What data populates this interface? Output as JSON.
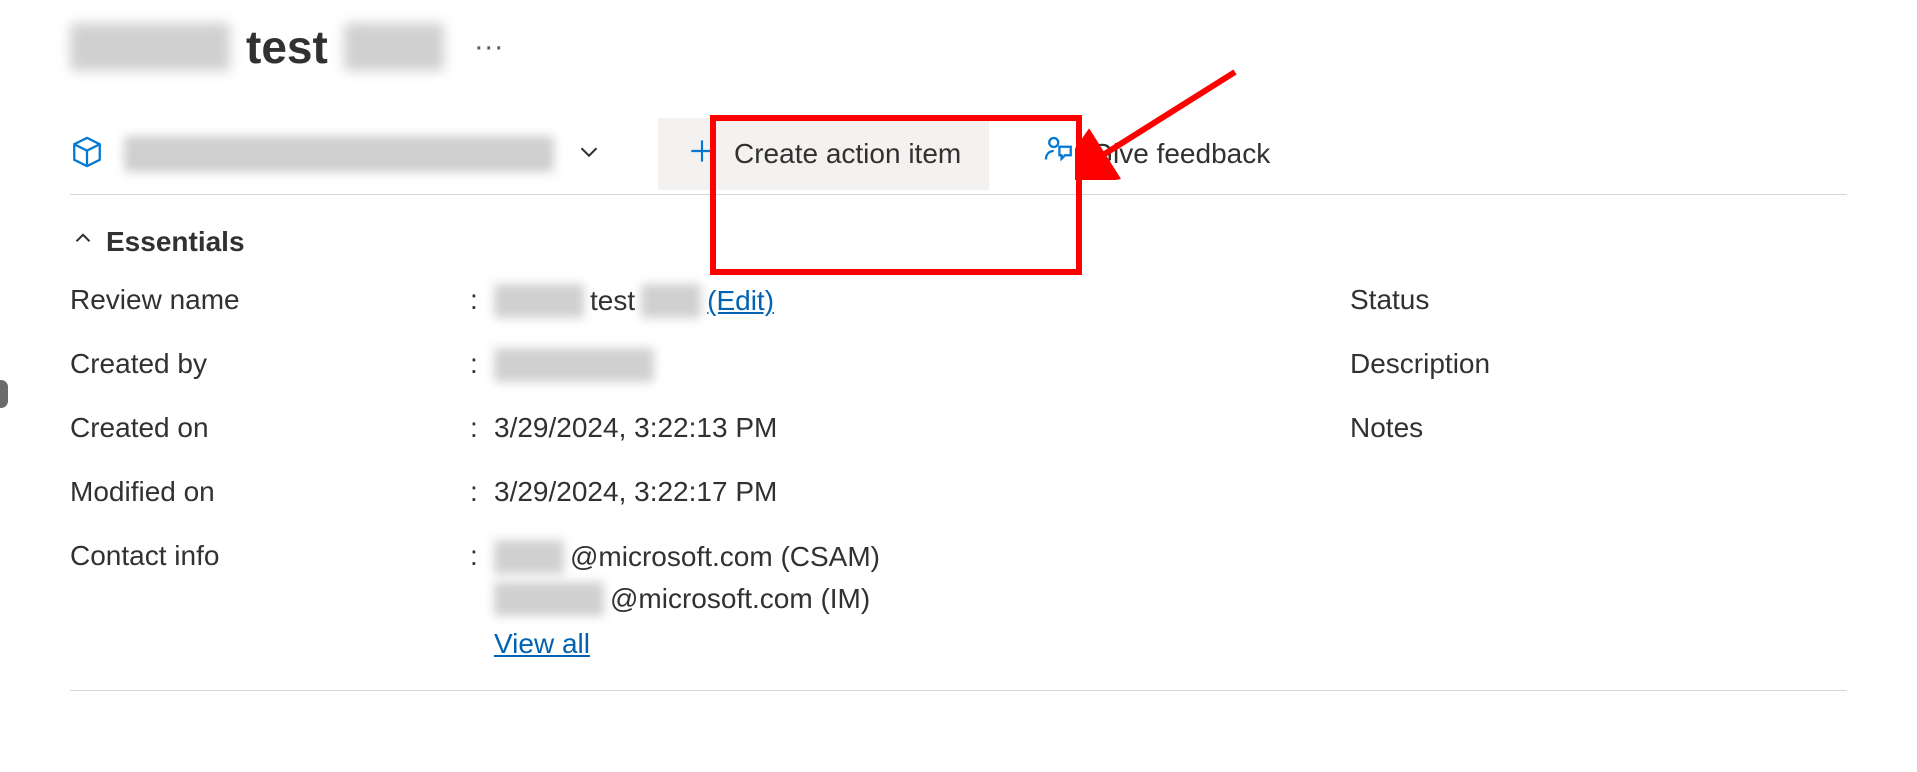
{
  "header": {
    "title_visible_part": "test",
    "more_icon_glyph": "···"
  },
  "toolbar": {
    "create_action_item_label": "Create action item",
    "give_feedback_label": "Give feedback"
  },
  "essentials": {
    "section_title": "Essentials",
    "left_rows": [
      {
        "label": "Review name",
        "value_visible": "test",
        "edit_link": "(Edit)"
      },
      {
        "label": "Created by"
      },
      {
        "label": "Created on",
        "value": "3/29/2024, 3:22:13 PM"
      },
      {
        "label": "Modified on",
        "value": "3/29/2024, 3:22:17 PM"
      }
    ],
    "contact_label": "Contact info",
    "contact_lines": {
      "line1_suffix": "@microsoft.com (CSAM)",
      "line2_suffix": "@microsoft.com (IM)",
      "view_all": "View all"
    },
    "right_rows": [
      {
        "label": "Status"
      },
      {
        "label": "Description"
      },
      {
        "label": "Notes"
      }
    ]
  }
}
